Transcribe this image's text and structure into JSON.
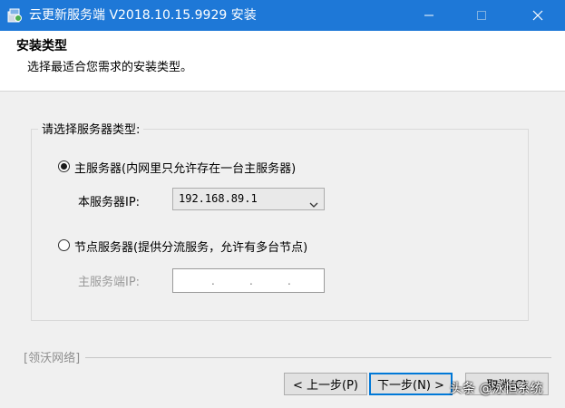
{
  "window": {
    "title": "云更新服务端 V2018.10.15.9929 安装",
    "accent": "#1e78d7"
  },
  "header": {
    "title": "安装类型",
    "subtitle": "选择最适合您需求的安装类型。"
  },
  "group": {
    "legend": "请选择服务器类型:",
    "main_server": {
      "label": "主服务器(内网里只允许存在一台主服务器)",
      "selected": true,
      "ip_label": "本服务器IP:",
      "ip_value": "192.168.89.1"
    },
    "node_server": {
      "label": "节点服务器(提供分流服务，允许有多台节点)",
      "selected": false,
      "ip_label": "主服务端IP:",
      "ip_placeholder": ". . ."
    }
  },
  "footer": {
    "brand": "[领沃网络]",
    "back_label": "< 上一步(P)",
    "next_label": "下一步(N) >",
    "cancel_label": "取消(C)",
    "watermark": "头条 @泳恒系统"
  },
  "icons": {
    "app": "installer-app-icon",
    "minimize": "minimize-icon",
    "maximize": "maximize-icon",
    "close": "close-icon",
    "dropdown": "chevron-down-icon"
  }
}
